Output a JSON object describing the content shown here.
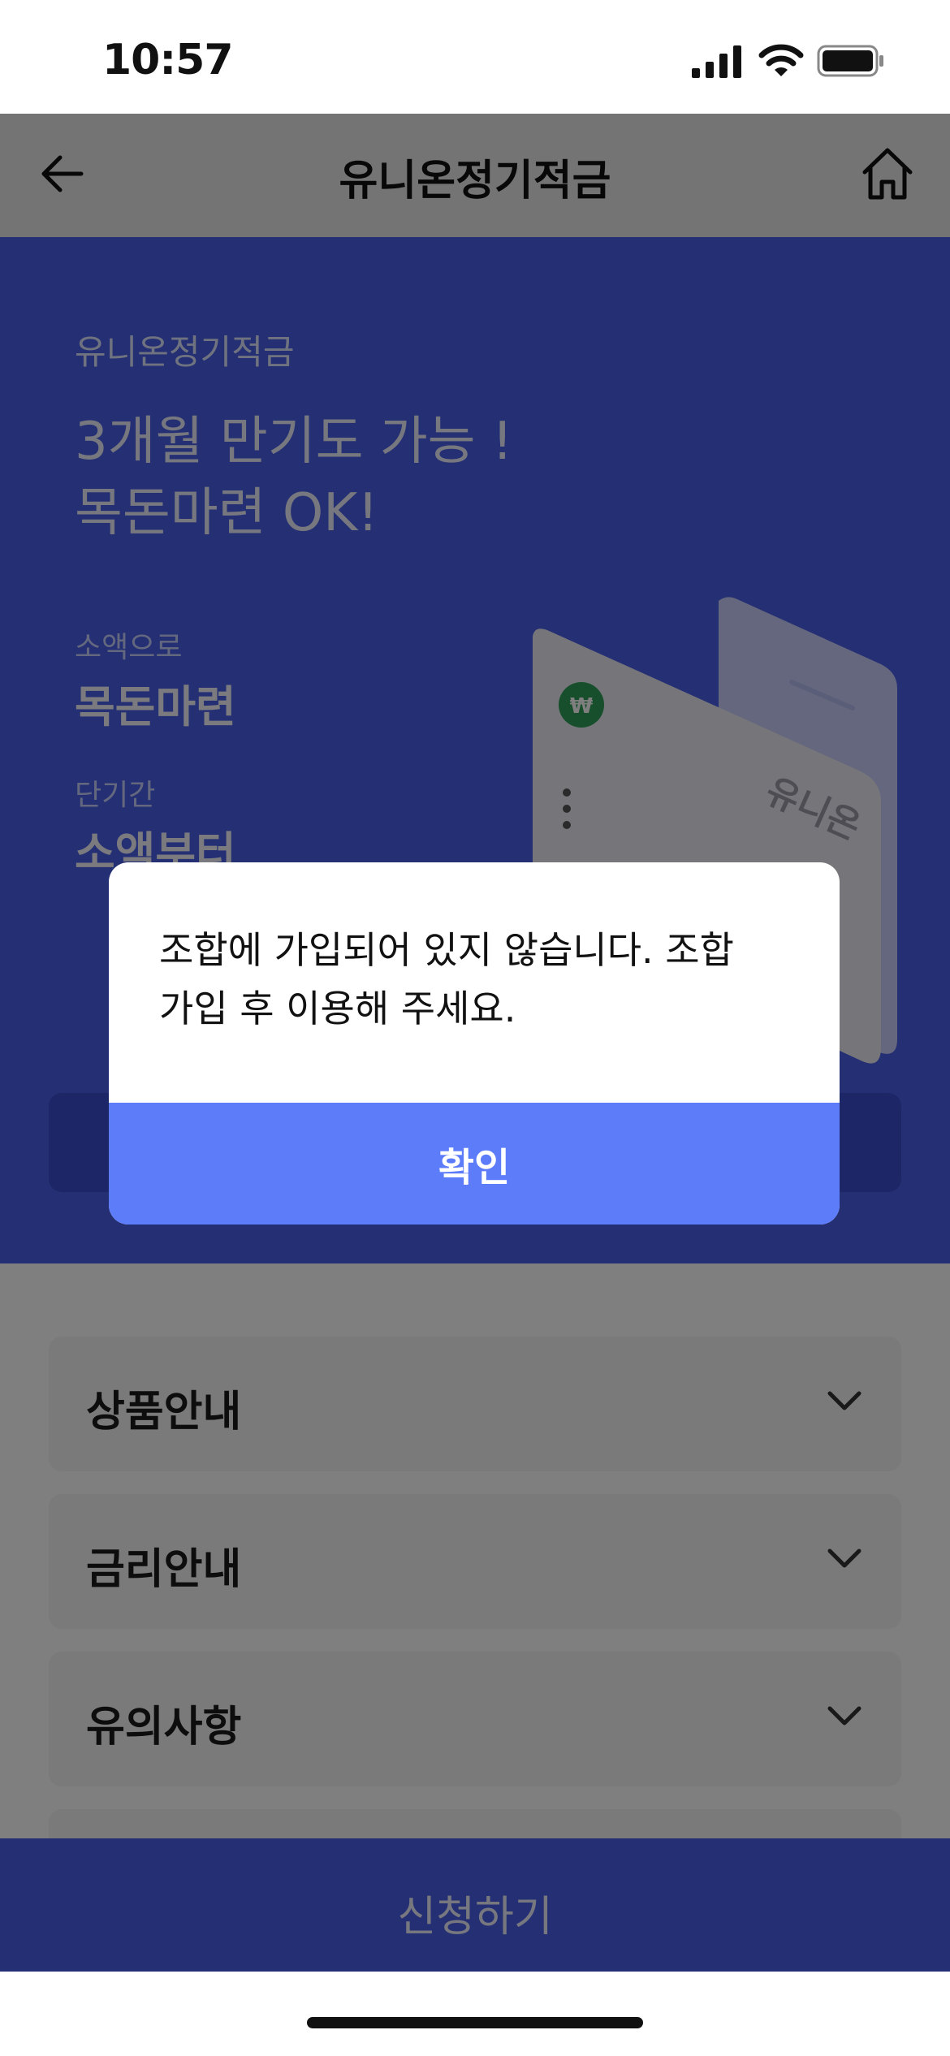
{
  "status_bar": {
    "time": "10:57"
  },
  "header": {
    "title": "유니온정기적금"
  },
  "hero": {
    "product_name": "유니온정기적금",
    "headline": "3개월 만기도 가능 !\n목돈마련 OK!",
    "features": [
      {
        "label": "소액으로",
        "value": "목돈마련"
      },
      {
        "label": "단기간",
        "value": "소액부터"
      }
    ],
    "card_text": "유니온"
  },
  "accordion": [
    {
      "label": "상품안내"
    },
    {
      "label": "금리안내"
    },
    {
      "label": "유의사항"
    }
  ],
  "apply_button": {
    "label": "신청하기"
  },
  "dialog": {
    "message": "조합에 가입되어 있지 않습니다. 조합 가입 후 이용해 주세요.",
    "confirm_label": "확인"
  },
  "colors": {
    "primary": "#4a5fe6",
    "dialog_button": "#5c7cfa",
    "card_badge": "#2e9e5b"
  }
}
